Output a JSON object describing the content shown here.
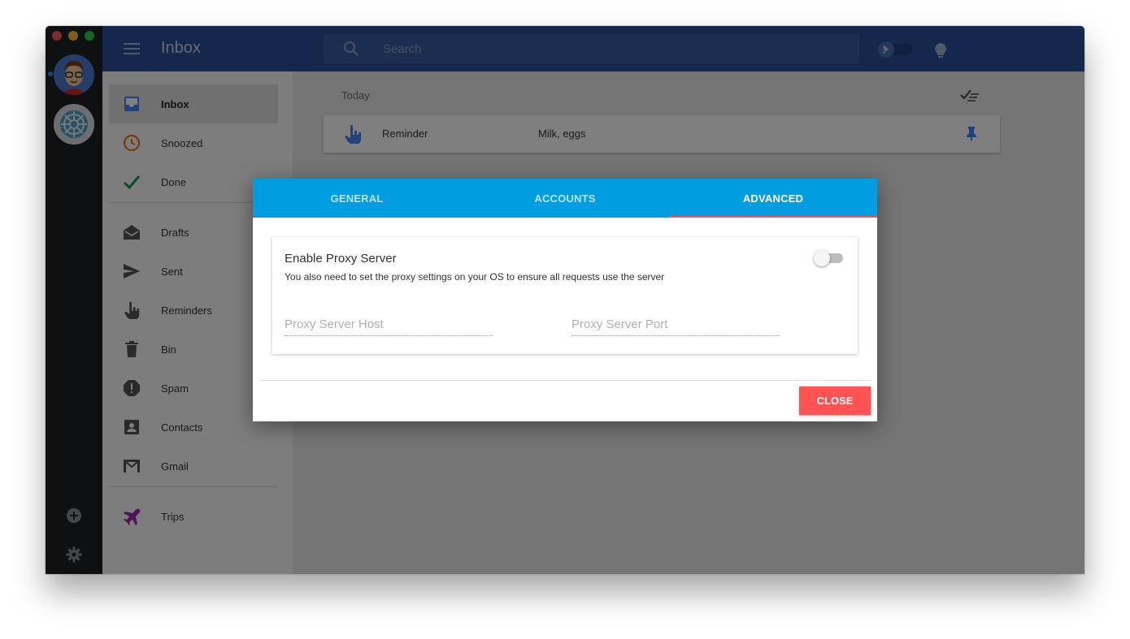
{
  "window": {
    "traffic_lights": [
      {
        "name": "close",
        "color": "#fc5753"
      },
      {
        "name": "minimize",
        "color": "#fdbc40"
      },
      {
        "name": "zoom",
        "color": "#33c748"
      }
    ]
  },
  "rail": {
    "accounts": [
      {
        "icon": "avatar-cartoon-icon",
        "active": true
      },
      {
        "icon": "avatar-wheel-icon",
        "active": false
      }
    ],
    "add_icon": "add-circle-icon",
    "settings_icon": "gear-icon"
  },
  "header": {
    "title": "Inbox",
    "search_placeholder": "Search",
    "pin_toggle_icon": "pin-icon",
    "hint_icon": "bulb-icon",
    "color": "#2a4e9a"
  },
  "sidebar": {
    "groups": [
      [
        {
          "label": "Inbox",
          "icon": "inbox-icon",
          "active": true,
          "color": "#4285f4"
        },
        {
          "label": "Snoozed",
          "icon": "clock-icon",
          "active": false,
          "color": "#e8710a"
        },
        {
          "label": "Done",
          "icon": "check-icon",
          "active": false,
          "color": "#0f9d58"
        }
      ],
      [
        {
          "label": "Drafts",
          "icon": "drafts-icon",
          "active": false,
          "color": "#555555"
        },
        {
          "label": "Sent",
          "icon": "send-icon",
          "active": false,
          "color": "#555555"
        },
        {
          "label": "Reminders",
          "icon": "reminder-hand-icon",
          "active": false,
          "color": "#555555"
        },
        {
          "label": "Bin",
          "icon": "trash-icon",
          "active": false,
          "color": "#555555"
        },
        {
          "label": "Spam",
          "icon": "spam-icon",
          "active": false,
          "color": "#555555"
        },
        {
          "label": "Contacts",
          "icon": "contacts-icon",
          "active": false,
          "color": "#555555"
        },
        {
          "label": "Gmail",
          "icon": "gmail-icon",
          "active": false,
          "color": "#555555"
        }
      ],
      [
        {
          "label": "Trips",
          "icon": "airplane-icon",
          "active": false,
          "color": "#9c27b0"
        }
      ]
    ]
  },
  "main": {
    "section_label": "Today",
    "mark_all_icon": "sweep-done-icon",
    "items": [
      {
        "sender": "Reminder",
        "snippet": "Milk, eggs",
        "icon": "reminder-hand-icon",
        "pin_icon": "pin-icon"
      }
    ],
    "fab_icon": "plus-icon",
    "fab_color": "#db4437"
  },
  "dialog": {
    "tabs": [
      {
        "label": "GENERAL",
        "active": false
      },
      {
        "label": "ACCOUNTS",
        "active": false
      },
      {
        "label": "ADVANCED",
        "active": true
      }
    ],
    "tab_color": "#019de1",
    "tab_indicator_color": "#ff4f5a",
    "proxy": {
      "title": "Enable Proxy Server",
      "description": "You also need to set the proxy settings on your OS to ensure all requests use the server",
      "enabled": false,
      "host_placeholder": "Proxy Server Host",
      "host_value": "",
      "port_placeholder": "Proxy Server Port",
      "port_value": ""
    },
    "close_label": "CLOSE",
    "close_color": "#ff5252"
  }
}
